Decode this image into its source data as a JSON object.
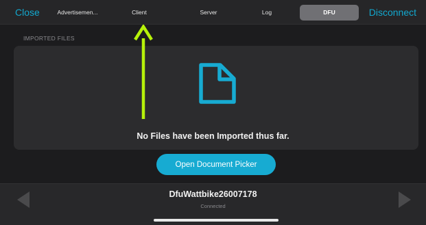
{
  "header": {
    "close_label": "Close",
    "disconnect_label": "Disconnect",
    "tabs": [
      {
        "label": "Advertisemen..."
      },
      {
        "label": "Client"
      },
      {
        "label": "Server"
      },
      {
        "label": "Log"
      },
      {
        "label": "DFU",
        "selected": true
      }
    ]
  },
  "files": {
    "section_label": "IMPORTED FILES",
    "icon": "document-icon",
    "empty_message": "No Files have been Imported thus far.",
    "picker_label": "Open Document Picker"
  },
  "device": {
    "name": "DfuWattbike26007178",
    "status": "Connected"
  },
  "nav": {
    "prev_icon": "left-arrow-icon",
    "next_icon": "right-arrow-icon"
  },
  "annotation": {
    "pointer_icon": "up-arrow-annotation-icon",
    "color": "#b6f10a"
  },
  "colors": {
    "accent": "#17abd2",
    "background": "#1c1c1e",
    "panel": "#2c2c2e"
  }
}
